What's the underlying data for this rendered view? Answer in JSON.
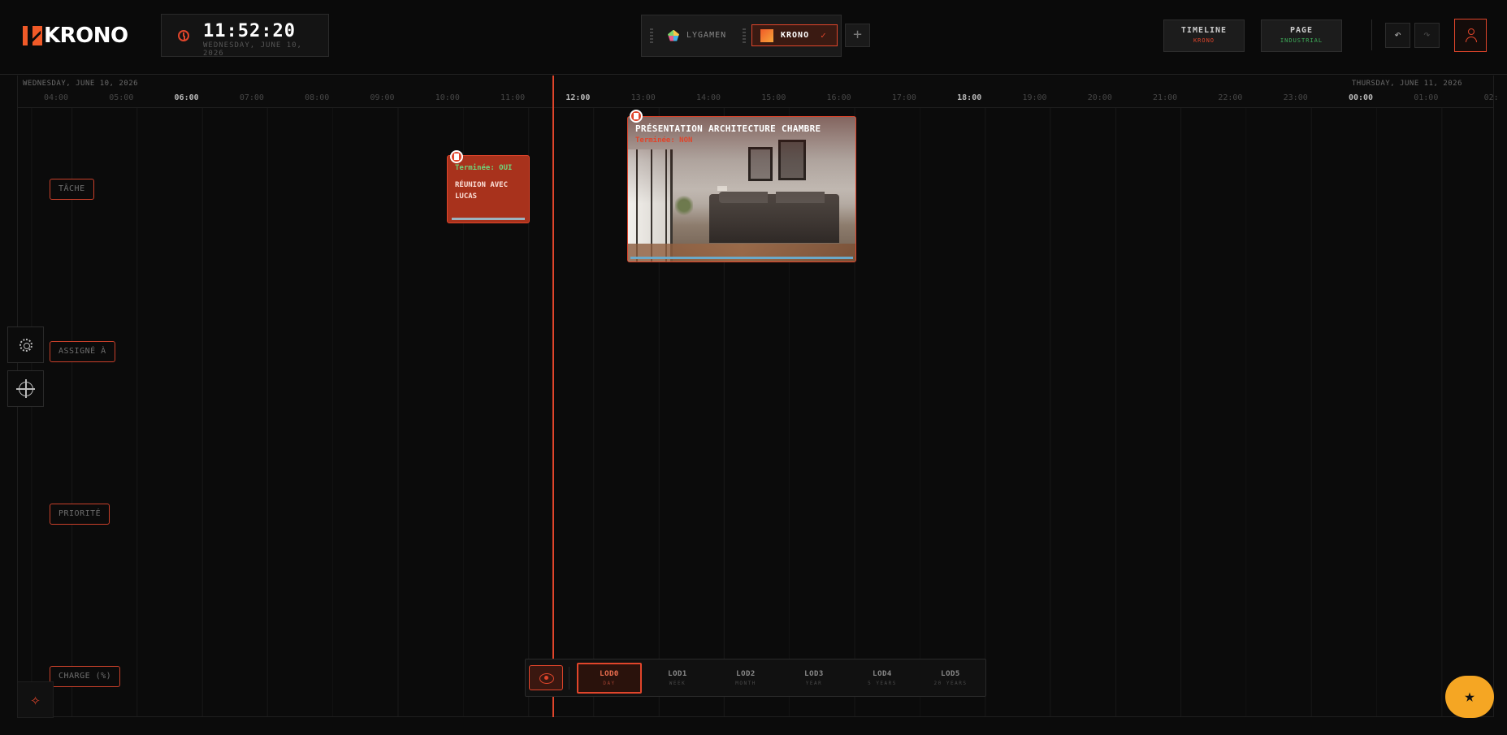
{
  "header": {
    "logo": "KRONO",
    "clock": {
      "time": "11:52:20",
      "date": "WEDNESDAY, JUNE 10, 2026"
    },
    "workspaces": [
      {
        "label": "LYGAMEN",
        "active": false
      },
      {
        "label": "KRONO",
        "active": true
      }
    ],
    "add_label": "+",
    "cards": {
      "timeline": {
        "title": "TIMELINE",
        "sub": "KRONO",
        "sub_color": "#e0452b"
      },
      "page": {
        "title": "PAGE",
        "sub": "INDUSTRIAL",
        "sub_color": "#3fae5a"
      }
    },
    "undo_symbol": "↶",
    "redo_symbol": "↷"
  },
  "timeline": {
    "day_left": "WEDNESDAY, JUNE 10, 2026",
    "day_right": "THURSDAY, JUNE 11, 2026",
    "hours": [
      "04:00",
      "05:00",
      "06:00",
      "07:00",
      "08:00",
      "09:00",
      "10:00",
      "11:00",
      "12:00",
      "13:00",
      "14:00",
      "15:00",
      "16:00",
      "17:00",
      "18:00",
      "19:00",
      "20:00",
      "21:00",
      "22:00",
      "23:00",
      "00:00",
      "01:00",
      "02:"
    ],
    "major_hours": [
      "06:00",
      "12:00",
      "18:00",
      "00:00"
    ],
    "row_labels": [
      "TÂCHE",
      "ASSIGNÉ À",
      "PRIORITÉ",
      "CHARGE (%)"
    ]
  },
  "events": {
    "small": {
      "status": "Terminée: OUI",
      "title": "RÉUNION AVEC LUCAS"
    },
    "big": {
      "title": "PRÉSENTATION ARCHITECTURE CHAMBRE",
      "status": "Terminée: NON"
    }
  },
  "lod": [
    {
      "code": "LOD0",
      "unit": "DAY",
      "active": true
    },
    {
      "code": "LOD1",
      "unit": "WEEK",
      "active": false
    },
    {
      "code": "LOD2",
      "unit": "MONTH",
      "active": false
    },
    {
      "code": "LOD3",
      "unit": "YEAR",
      "active": false
    },
    {
      "code": "LOD4",
      "unit": "5 YEARS",
      "active": false
    },
    {
      "code": "LOD5",
      "unit": "20 YEARS",
      "active": false
    }
  ],
  "icons": {
    "sparkle": "✧",
    "favorite": "★",
    "check": "✓"
  },
  "colors": {
    "accent": "#e0452b",
    "favorite": "#f5a623",
    "success": "#6fd47a"
  }
}
